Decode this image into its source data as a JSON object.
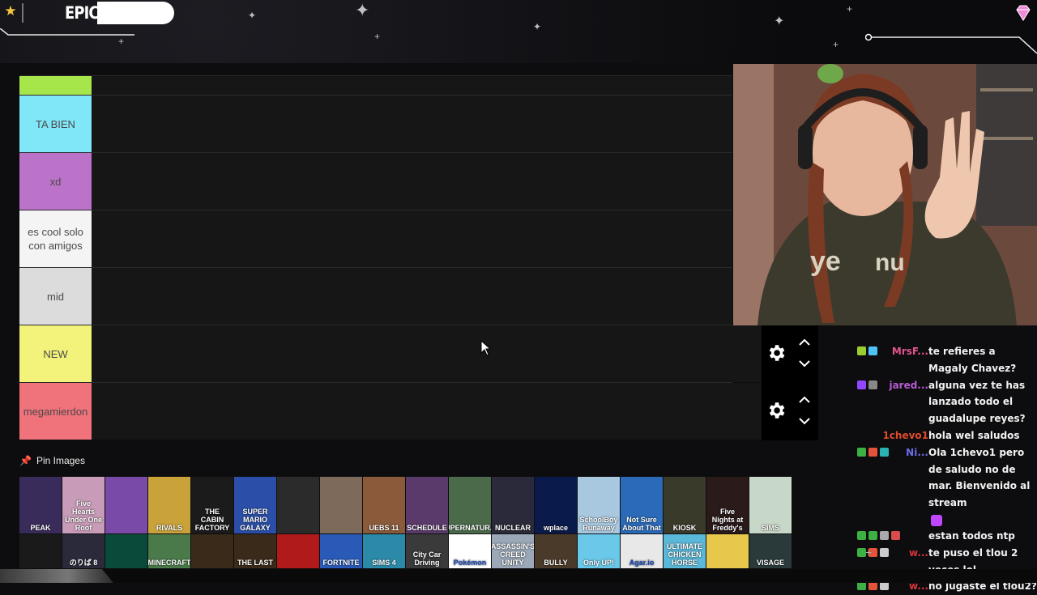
{
  "overlay": {
    "logo": "EPIC"
  },
  "tiers": [
    {
      "label": "",
      "color": "#a6e64b"
    },
    {
      "label": "TA BIEN",
      "color": "#7fe7f7"
    },
    {
      "label": "xd",
      "color": "#bb72c9"
    },
    {
      "label": "es cool solo con amigos",
      "color": "#f4f4f4"
    },
    {
      "label": "mid",
      "color": "#dcdcdc"
    },
    {
      "label": "NEW",
      "color": "#f3f27a"
    },
    {
      "label": "megamierdon",
      "color": "#f0727b"
    }
  ],
  "pin_images": {
    "title": "Pin Images",
    "row1": [
      "PEAK",
      "Five Hearts Under One Roof",
      "",
      "RIVALS",
      "THE CABIN FACTORY",
      "SUPER MARIO GALAXY",
      "",
      "",
      "UEBS 11",
      "SCHEDULE",
      "SUPERNATURAL",
      "NUCLEAR",
      "wplace",
      "SchoolBoy Runaway",
      "Not Sure About That",
      "KIOSK",
      "Five Nights at Freddy's",
      "SIMS"
    ],
    "row2": [
      "",
      "のりば 8",
      "",
      "MINECRAFT",
      "",
      "THE LAST",
      "",
      "FORTNITE",
      "SIMS 4",
      "City Car Driving",
      "Pokémon",
      "ASSASSIN'S CREED UNITY",
      "BULLY",
      "Only UP!",
      "Agar.io",
      "ULTIMATE CHICKEN HORSE",
      "",
      "VISAGE"
    ]
  },
  "chat": [
    {
      "user": "MrsF...",
      "user_color": "#e4548f",
      "text": "te refieres a Magaly Chavez?"
    },
    {
      "user": "jared...",
      "user_color": "#b75ad3",
      "text": "alguna vez te has lanzado todo el guadalupe reyes?"
    },
    {
      "user": "1chevo1",
      "user_color": "#e04b2b",
      "text": "hola wel saludos"
    },
    {
      "user": "Ni...",
      "user_color": "#6c6ce6",
      "text": "Ola 1chevo1 pero de saludo no de mar. Bienvenido al stream"
    },
    {
      "user": "",
      "user_color": "#ffffff",
      "text": "estan todos ntp"
    },
    {
      "user": "w...",
      "user_color": "#d9343b",
      "text": "te puso el tlou 2 veces lol"
    },
    {
      "user": "w...",
      "user_color": "#d9343b",
      "text": "no jugaste el tlou2?"
    }
  ]
}
